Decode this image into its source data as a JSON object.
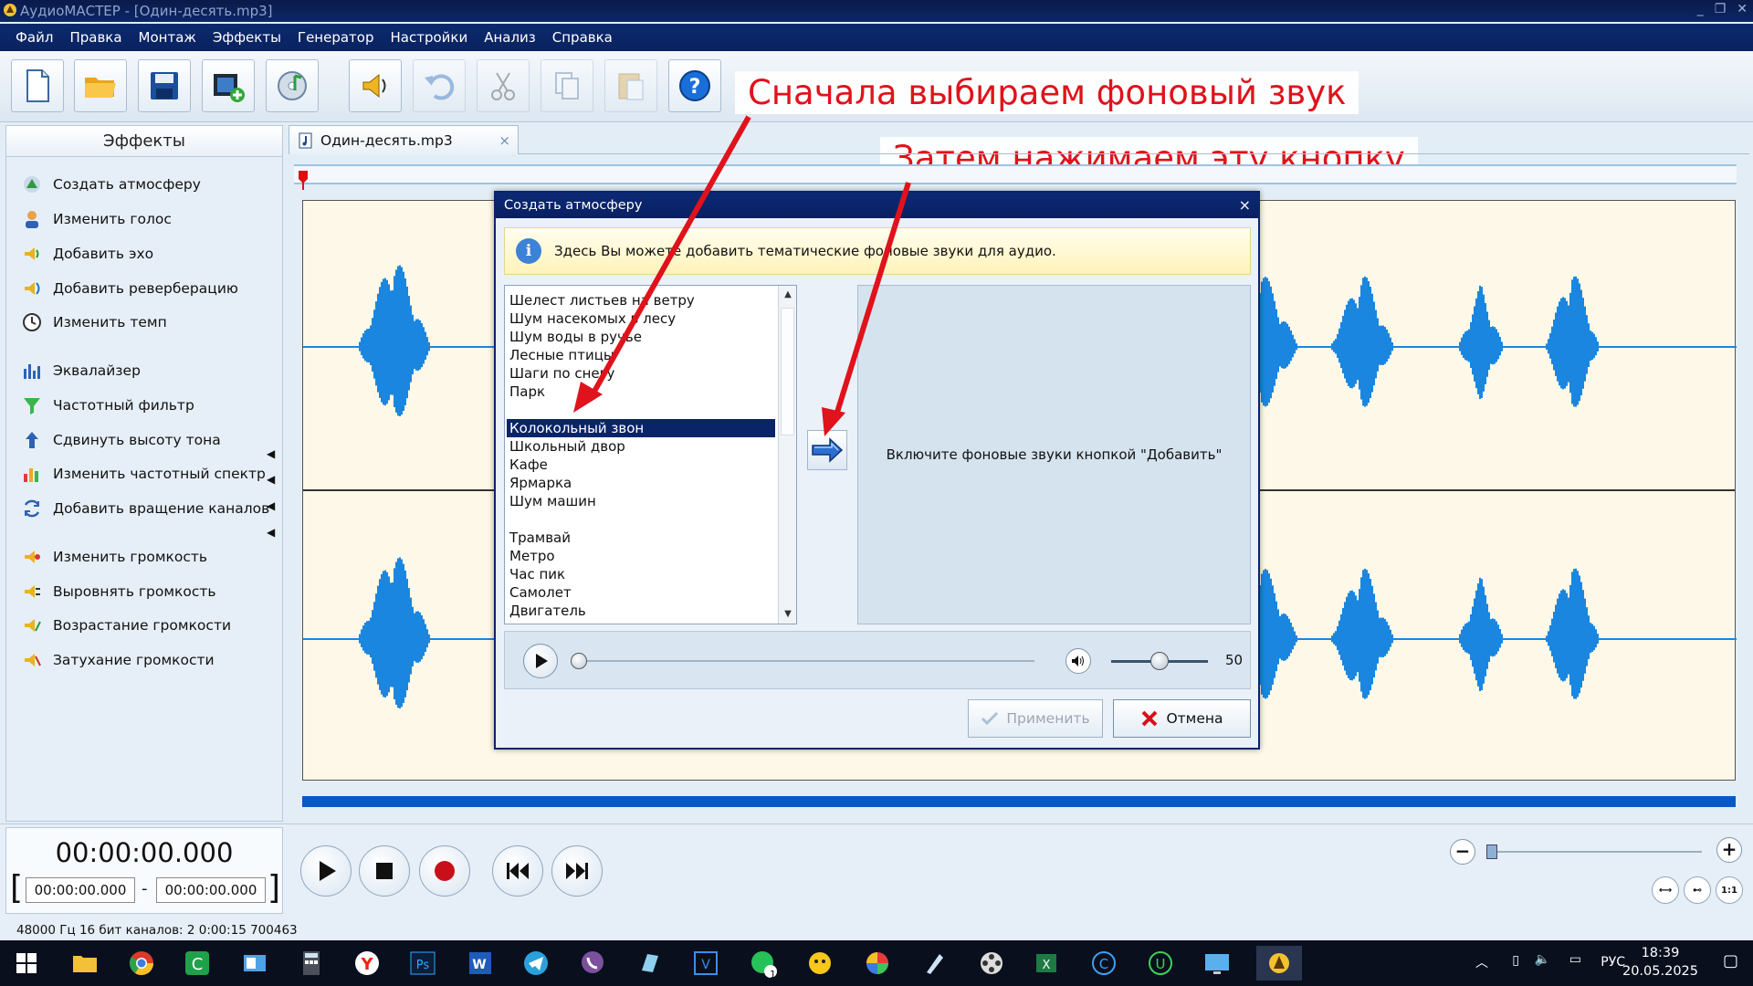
{
  "window": {
    "title": "АудиоМАСТЕР - [Один-десять.mp3]"
  },
  "menu": [
    "Файл",
    "Правка",
    "Монтаж",
    "Эффекты",
    "Генератор",
    "Настройки",
    "Анализ",
    "Справка"
  ],
  "annotations": {
    "first": "Сначала выбираем фоновый звук",
    "second": "Затем нажимаем эту кнопку"
  },
  "effects_panel": {
    "title": "Эффекты",
    "items": [
      "Создать атмосферу",
      "Изменить голос",
      "Добавить эхо",
      "Добавить реверберацию",
      "Изменить темп",
      "Эквалайзер",
      "Частотный фильтр",
      "Сдвинуть высоту тона",
      "Изменить частотный спектр",
      "Добавить вращение каналов",
      "Изменить громкость",
      "Выровнять громкость",
      "Возрастание громкости",
      "Затухание громкости"
    ]
  },
  "file_tab": {
    "label": "Один-десять.mp3",
    "close": "×"
  },
  "time": {
    "current": "00:00:00.000",
    "start": "00:00:00.000",
    "end": "00:00:00.000",
    "separator": "-"
  },
  "status": "48000 Гц  16 бит  каналов: 2  0:00:15 700463",
  "zoom": {
    "minus": "−",
    "plus": "+",
    "fit_label": "1:1"
  },
  "taskbar": {
    "language": "РУС",
    "time": "18:39",
    "date": "20.05.2025",
    "whatsapp_badge": "12"
  },
  "dialog": {
    "title": "Создать атмосферу",
    "close": "×",
    "info": "Здесь Вы можете добавить тематические фоновые звуки для аудио.",
    "sounds": [
      "Шелест листьев на ветру",
      "Шум насекомых в лесу",
      "Шум воды в ручье",
      "Лесные птицы",
      "Шаги по снегу",
      "Парк",
      "",
      "Колокольный звон",
      "Школьный двор",
      "Кафе",
      "Ярмарка",
      "Шум машин",
      "",
      "Трамвай",
      "Метро",
      "Час пик",
      "Самолет",
      "Двигатель"
    ],
    "selected_index": 7,
    "target_hint": "Включите фоновые звуки кнопкой \"Добавить\"",
    "volume": "50",
    "apply_label": "Применить",
    "cancel_label": "Отмена"
  },
  "colors": {
    "accent": "#0b246a",
    "wave": "#1a86e0",
    "annotation": "#e0121b"
  }
}
